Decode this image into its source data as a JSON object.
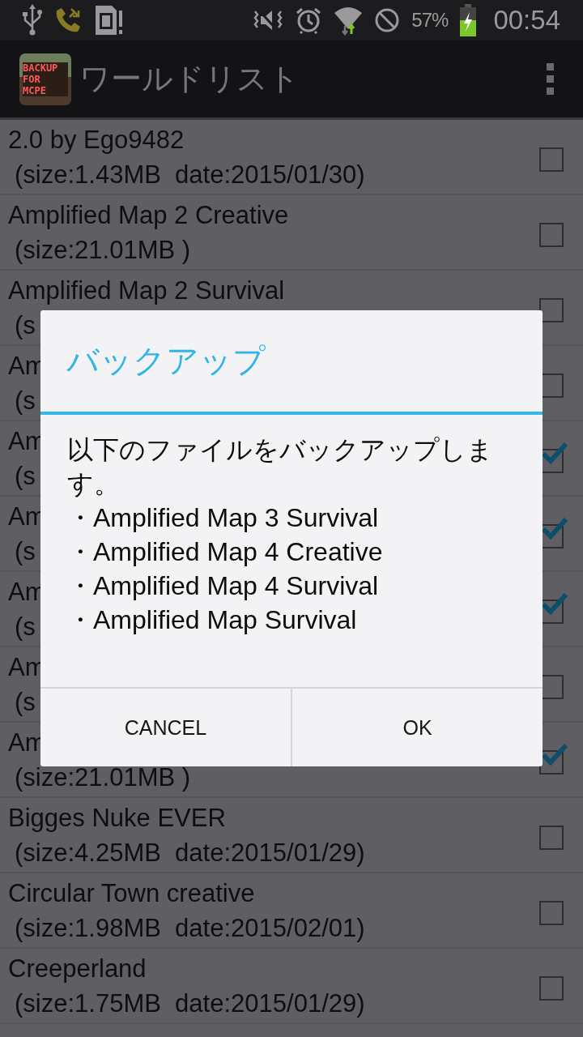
{
  "status_bar": {
    "battery_text": "57%",
    "time": "00:54"
  },
  "app_bar": {
    "logo_text": "BACKUP FOR MCPE",
    "title": "ワールドリスト"
  },
  "worlds": [
    {
      "name": "2.0 by Ego9482",
      "detail": "(size:1.43MB  date:2015/01/30)",
      "checked": false
    },
    {
      "name": "Amplified Map 2 Creative",
      "detail": "(size:21.01MB )",
      "checked": false
    },
    {
      "name": "Amplified Map 2 Survival",
      "detail": "(s",
      "checked": false
    },
    {
      "name": "Am",
      "detail": "(s",
      "checked": false
    },
    {
      "name": "Am",
      "detail": "(s",
      "checked": true
    },
    {
      "name": "Am",
      "detail": "(s",
      "checked": true
    },
    {
      "name": "Am",
      "detail": "(s",
      "checked": true
    },
    {
      "name": "Am",
      "detail": "(s",
      "checked": false
    },
    {
      "name": "Am",
      "detail": "(size:21.01MB )",
      "checked": true
    },
    {
      "name": "Bigges Nuke EVER",
      "detail": "(size:4.25MB  date:2015/01/29)",
      "checked": false
    },
    {
      "name": "Circular Town creative",
      "detail": "(size:1.98MB  date:2015/02/01)",
      "checked": false
    },
    {
      "name": "Creeperland",
      "detail": "(size:1.75MB  date:2015/01/29)",
      "checked": false
    }
  ],
  "dialog": {
    "title": "バックアップ",
    "message": "以下のファイルをバックアップします。",
    "files": [
      "・Amplified Map 3 Survival",
      "・Amplified Map 4 Creative",
      "・Amplified Map 4 Survival",
      "・Amplified Map Survival"
    ],
    "buttons": [
      "CANCEL",
      "OK"
    ]
  }
}
